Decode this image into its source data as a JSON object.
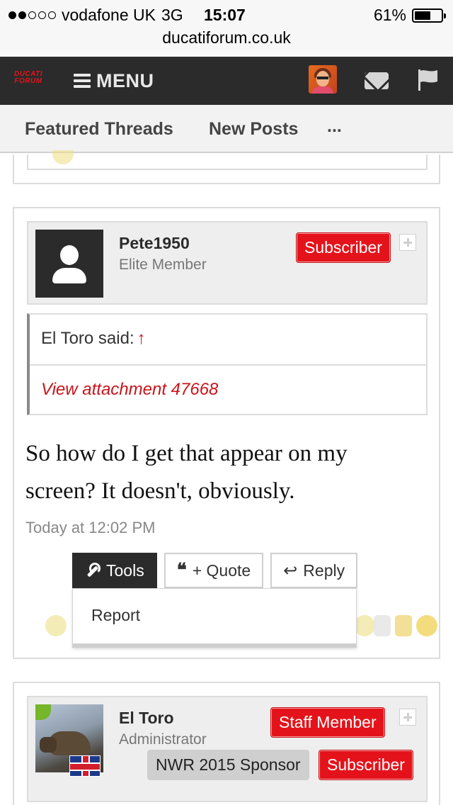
{
  "status": {
    "carrier": "vodafone UK",
    "network": "3G",
    "time": "15:07",
    "battery": "61%",
    "battery_level": 0.61
  },
  "browser": {
    "url": "ducatiforum.co.uk"
  },
  "nav": {
    "logo_line1": "DUCATI",
    "logo_line2": "FORUM",
    "menu_label": "MENU",
    "icons": [
      "hamburger-icon",
      "avatar",
      "mail-icon",
      "flag-icon"
    ]
  },
  "tabs": {
    "featured": "Featured Threads",
    "new_posts": "New Posts",
    "more": "..."
  },
  "post1": {
    "username": "Pete1950",
    "user_title": "Elite Member",
    "badge": "Subscriber",
    "quote_author": "El Toro said:",
    "quote_arrow": "↑",
    "quote_link": "View attachment 47668",
    "body": "So how do I get that appear on my screen? It doesn't, obviously.",
    "time": "Today at 12:02 PM",
    "actions": {
      "tools": "Tools",
      "quote": "+ Quote",
      "reply": "Reply"
    },
    "tools_menu": {
      "report": "Report"
    }
  },
  "post2": {
    "username": "El Toro",
    "user_title": "Administrator",
    "badges": {
      "staff": "Staff Member",
      "sponsor": "NWR 2015 Sponsor",
      "subscriber": "Subscriber"
    }
  },
  "colors": {
    "brand_red": "#e4131b",
    "nav_dark": "#2b2b2b",
    "quote_link": "#c8141b"
  }
}
